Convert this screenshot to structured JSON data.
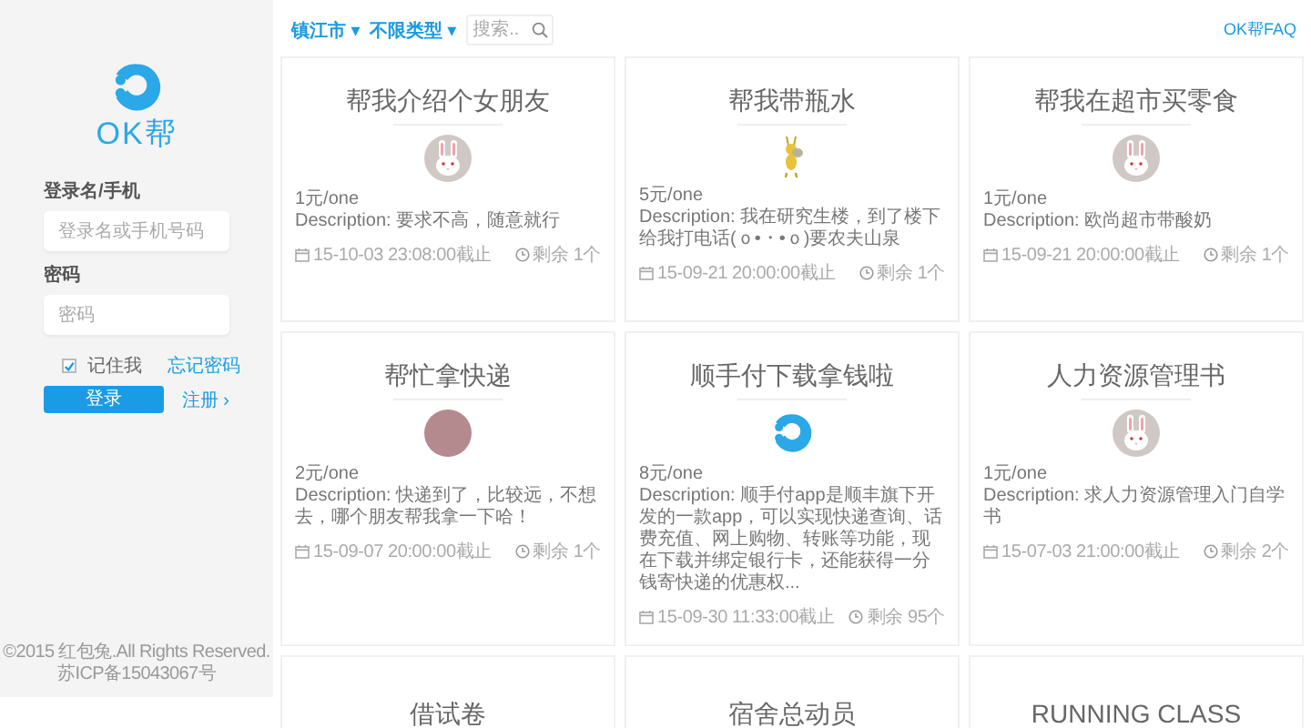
{
  "sidebar": {
    "logo_text": "OK帮",
    "fields": [
      {
        "label": "登录名/手机",
        "placeholder": "登录名或手机号码"
      },
      {
        "label": "密码",
        "placeholder": "密码"
      }
    ],
    "remember": {
      "label": "记住我",
      "checked": true
    },
    "forgot_link": "忘记密码",
    "login_button": "登录",
    "register_link": "注册 ›",
    "footer": [
      "©2015 红包兔.All Rights Reserved.",
      "苏ICP备15043067号"
    ]
  },
  "toolbar": {
    "filters": [
      {
        "label": "镇江市 ▾"
      },
      {
        "label": "不限类型 ▾"
      }
    ],
    "search": {
      "placeholder": "搜索.."
    },
    "faq_link": "OK帮FAQ"
  },
  "cards": [
    {
      "title": "帮我介绍个女朋友",
      "kind": "rabbit",
      "price": "1元/one",
      "description": "Description: 要求不高，随意就行",
      "deadline": "15-10-03 23:08:00截止",
      "remaining": "剩余 1个"
    },
    {
      "title": "帮我带瓶水",
      "kind": "bee",
      "price": "5元/one",
      "description": "Description: 我在研究生楼，到了楼下给我打电话(ｏ•・•ｏ)要农夫山泉",
      "deadline": "15-09-21 20:00:00截止",
      "remaining": "剩余 1个"
    },
    {
      "title": "帮我在超市买零食",
      "kind": "rabbit",
      "price": "1元/one",
      "description": "Description: 欧尚超市带酸奶",
      "deadline": "15-09-21 20:00:00截止",
      "remaining": "剩余 1个"
    },
    {
      "title": "帮忙拿快递",
      "kind": "photo",
      "price": "2元/one",
      "description": "Description: 快递到了，比较远，不想去，哪个朋友帮我拿一下哈！",
      "deadline": "15-09-07 20:00:00截止",
      "remaining": "剩余 1个"
    },
    {
      "title": "顺手付下载拿钱啦",
      "kind": "logo",
      "price": "8元/one",
      "description": "Description: 顺手付app是顺丰旗下开发的一款app，可以实现快递查询、话费充值、网上购物、转账等功能，现在下载并绑定银行卡，还能获得一分钱寄快递的优惠权...",
      "deadline": "15-09-30 11:33:00截止",
      "remaining": "剩余 95个"
    },
    {
      "title": "人力资源管理书",
      "kind": "rabbit",
      "price": "1元/one",
      "description": "Description: 求人力资源管理入门自学书",
      "deadline": "15-07-03 21:00:00截止",
      "remaining": "剩余 2个"
    },
    {
      "title": "借试卷"
    },
    {
      "title": "宿舍总动员"
    },
    {
      "title": "RUNNING CLASS"
    }
  ]
}
